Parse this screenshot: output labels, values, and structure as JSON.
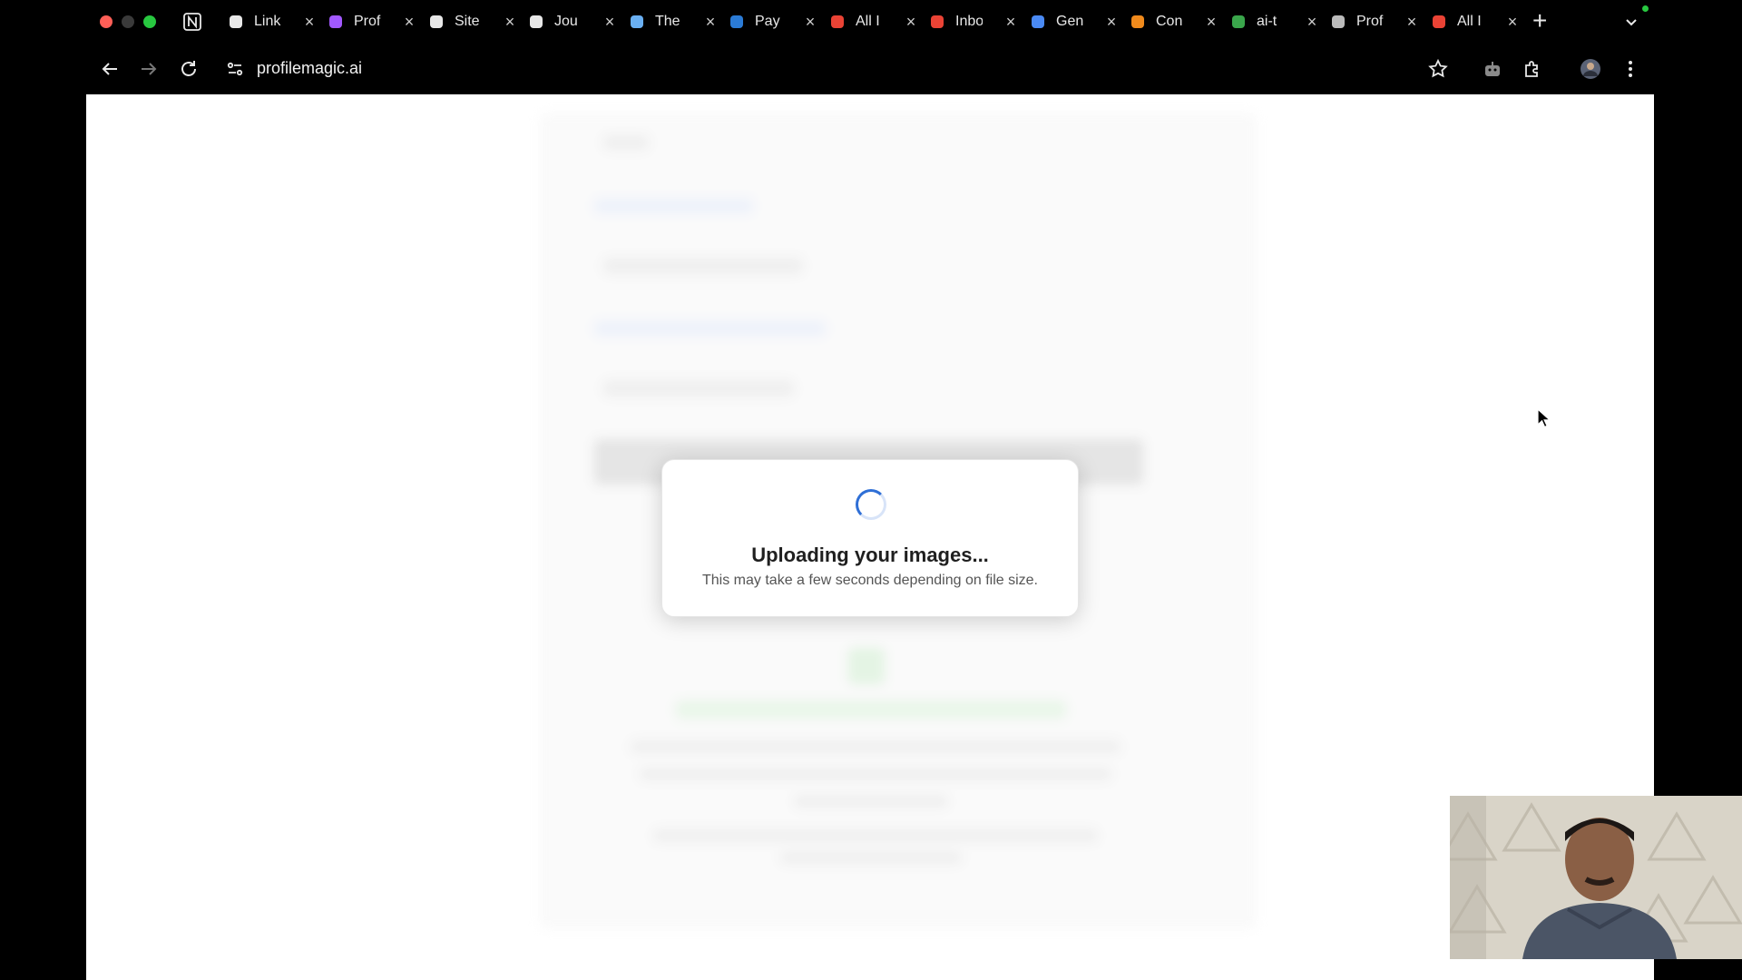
{
  "browser": {
    "tabs": [
      {
        "title": "Link",
        "icon": "openai-icon",
        "color": "#e8e8e8"
      },
      {
        "title": "Prof",
        "icon": "vite-logo-icon",
        "color": "#a259ff"
      },
      {
        "title": "Site",
        "icon": "notion-icon",
        "color": "#e8e8e8"
      },
      {
        "title": "Jou",
        "icon": "notion-icon",
        "color": "#e8e8e8"
      },
      {
        "title": "The",
        "icon": "aperture-icon",
        "color": "#6ab0f3"
      },
      {
        "title": "Pay",
        "icon": "paypal-icon",
        "color": "#2b7bd6"
      },
      {
        "title": "All I",
        "icon": "gmail-icon",
        "color": "#ea4335"
      },
      {
        "title": "Inbo",
        "icon": "gmail-icon",
        "color": "#ea4335"
      },
      {
        "title": "Gen",
        "icon": "gemini-icon",
        "color": "#4a8af4"
      },
      {
        "title": "Con",
        "icon": "hexagon-icon",
        "color": "#f08a1c"
      },
      {
        "title": "ai-t",
        "icon": "chatbot-icon",
        "color": "#3aa64b"
      },
      {
        "title": "Prof",
        "icon": "photo-icon",
        "color": "#bbbbbb"
      },
      {
        "title": "All I",
        "icon": "gmail-icon",
        "color": "#ea4335"
      }
    ],
    "url": "profilemagic.ai"
  },
  "modal": {
    "title": "Uploading your images...",
    "subtitle": "This may take a few seconds depending on file size."
  }
}
